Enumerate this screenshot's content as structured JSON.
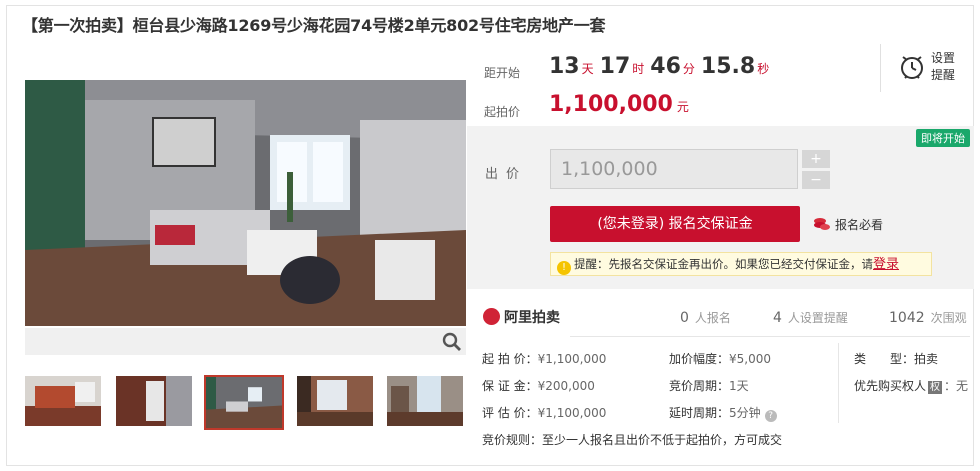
{
  "listing": {
    "title": "【第一次拍卖】桓台县少海路1269号少海花园74号楼2单元802号住宅房地产一套"
  },
  "countdown": {
    "label": "距开始",
    "days": "13",
    "days_unit": "天",
    "hours": "17",
    "hours_unit": "时",
    "minutes": "46",
    "minutes_unit": "分",
    "seconds": "15.8",
    "seconds_unit": "秒"
  },
  "start_price": {
    "label": "起拍价",
    "value": "1,100,000",
    "unit": "元"
  },
  "reminder": {
    "label": "设置提醒",
    "icon": "alarm-clock-icon"
  },
  "bid_panel": {
    "status_badge": "即将开始",
    "bid_label": "出价",
    "bid_value": "1,100,000",
    "increment": "+",
    "decrement": "−",
    "deposit_button": "(您未登录) 报名交保证金",
    "must_read": "报名必看",
    "hint_text": "提醒：先报名交保证金再出价。如果您已经交付保证金，请",
    "login_link": "登录"
  },
  "stats": {
    "brand": "阿里拍卖",
    "registered_count": "0",
    "registered_label": "人报名",
    "reminder_count": "4",
    "reminder_label": "人设置提醒",
    "views_count": "1042",
    "views_label": "次围观"
  },
  "details": {
    "start_price_k": "起 拍 价：",
    "start_price_v": "¥1,100,000",
    "deposit_k": "保 证 金：",
    "deposit_v": "¥200,000",
    "appraisal_k": "评 估 价：",
    "appraisal_v": "¥1,100,000",
    "increment_k": "加价幅度：",
    "increment_v": "¥5,000",
    "cycle_k": "竞价周期：",
    "cycle_v": "1天",
    "delay_k": "延时周期：",
    "delay_v": "5分钟",
    "type_k": "类　　型：",
    "type_v": "拍卖",
    "priority_k": "优先购买权人",
    "priority_badge": "权",
    "priority_v": "：无",
    "rule_k": "竞价规则：",
    "rule_v": "至少一人报名且出价不低于起拍价，方可成交"
  },
  "colors": {
    "accent_red": "#c8102e",
    "badge_green": "#1aa86b",
    "panel_grey": "#f2f2f2"
  }
}
